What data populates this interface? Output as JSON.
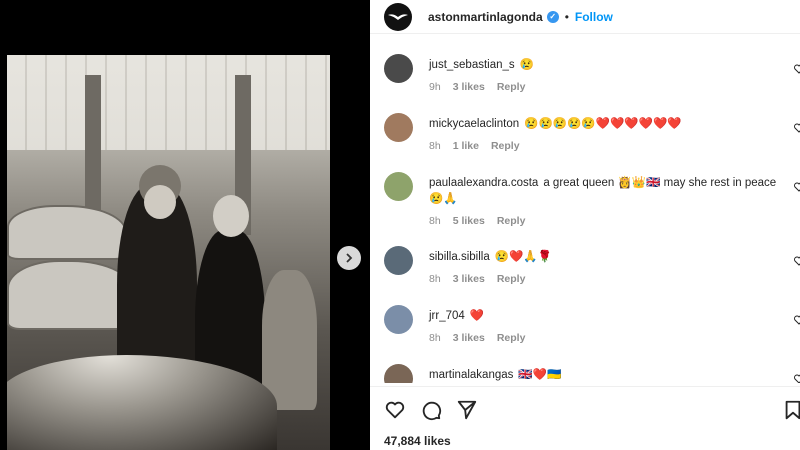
{
  "post": {
    "handle": "astonmartinlagonda",
    "verified_mark": "✓",
    "separator": "•",
    "follow_label": "Follow",
    "likes_count": "47,884 likes"
  },
  "comments": [
    {
      "user": "just_sebastian_s",
      "text": "😢",
      "time": "9h",
      "likes": "3 likes",
      "reply": "Reply",
      "avatar_color": "#4a4a4a"
    },
    {
      "user": "mickycaelaclinton",
      "text": "😢😢😢😢😢❤️❤️❤️❤️❤️❤️",
      "time": "8h",
      "likes": "1 like",
      "reply": "Reply",
      "avatar_color": "#a07a5f"
    },
    {
      "user": "paulaalexandra.costa",
      "text": "a great queen 👸👑🇬🇧 may she rest in peace 😢🙏",
      "time": "8h",
      "likes": "5 likes",
      "reply": "Reply",
      "avatar_color": "#8ea36b"
    },
    {
      "user": "sibilla.sibilla",
      "text": "😢❤️🙏🌹",
      "time": "8h",
      "likes": "3 likes",
      "reply": "Reply",
      "avatar_color": "#5a6a78"
    },
    {
      "user": "jrr_704",
      "text": "❤️",
      "time": "8h",
      "likes": "3 likes",
      "reply": "Reply",
      "avatar_color": "#7b8ea8"
    },
    {
      "user": "martinalakangas",
      "text": "🇬🇧❤️🇺🇦",
      "time": "",
      "likes": "",
      "reply": "",
      "avatar_color": "#7a6656"
    }
  ],
  "colors": {
    "accent": "#0095f6",
    "verified": "#3797f0",
    "meta_text": "#8e8e8e"
  },
  "icons": {
    "next": "chevron-right-icon",
    "like": "heart-icon",
    "comment": "comment-icon",
    "share": "paper-plane-icon",
    "save": "bookmark-icon"
  }
}
